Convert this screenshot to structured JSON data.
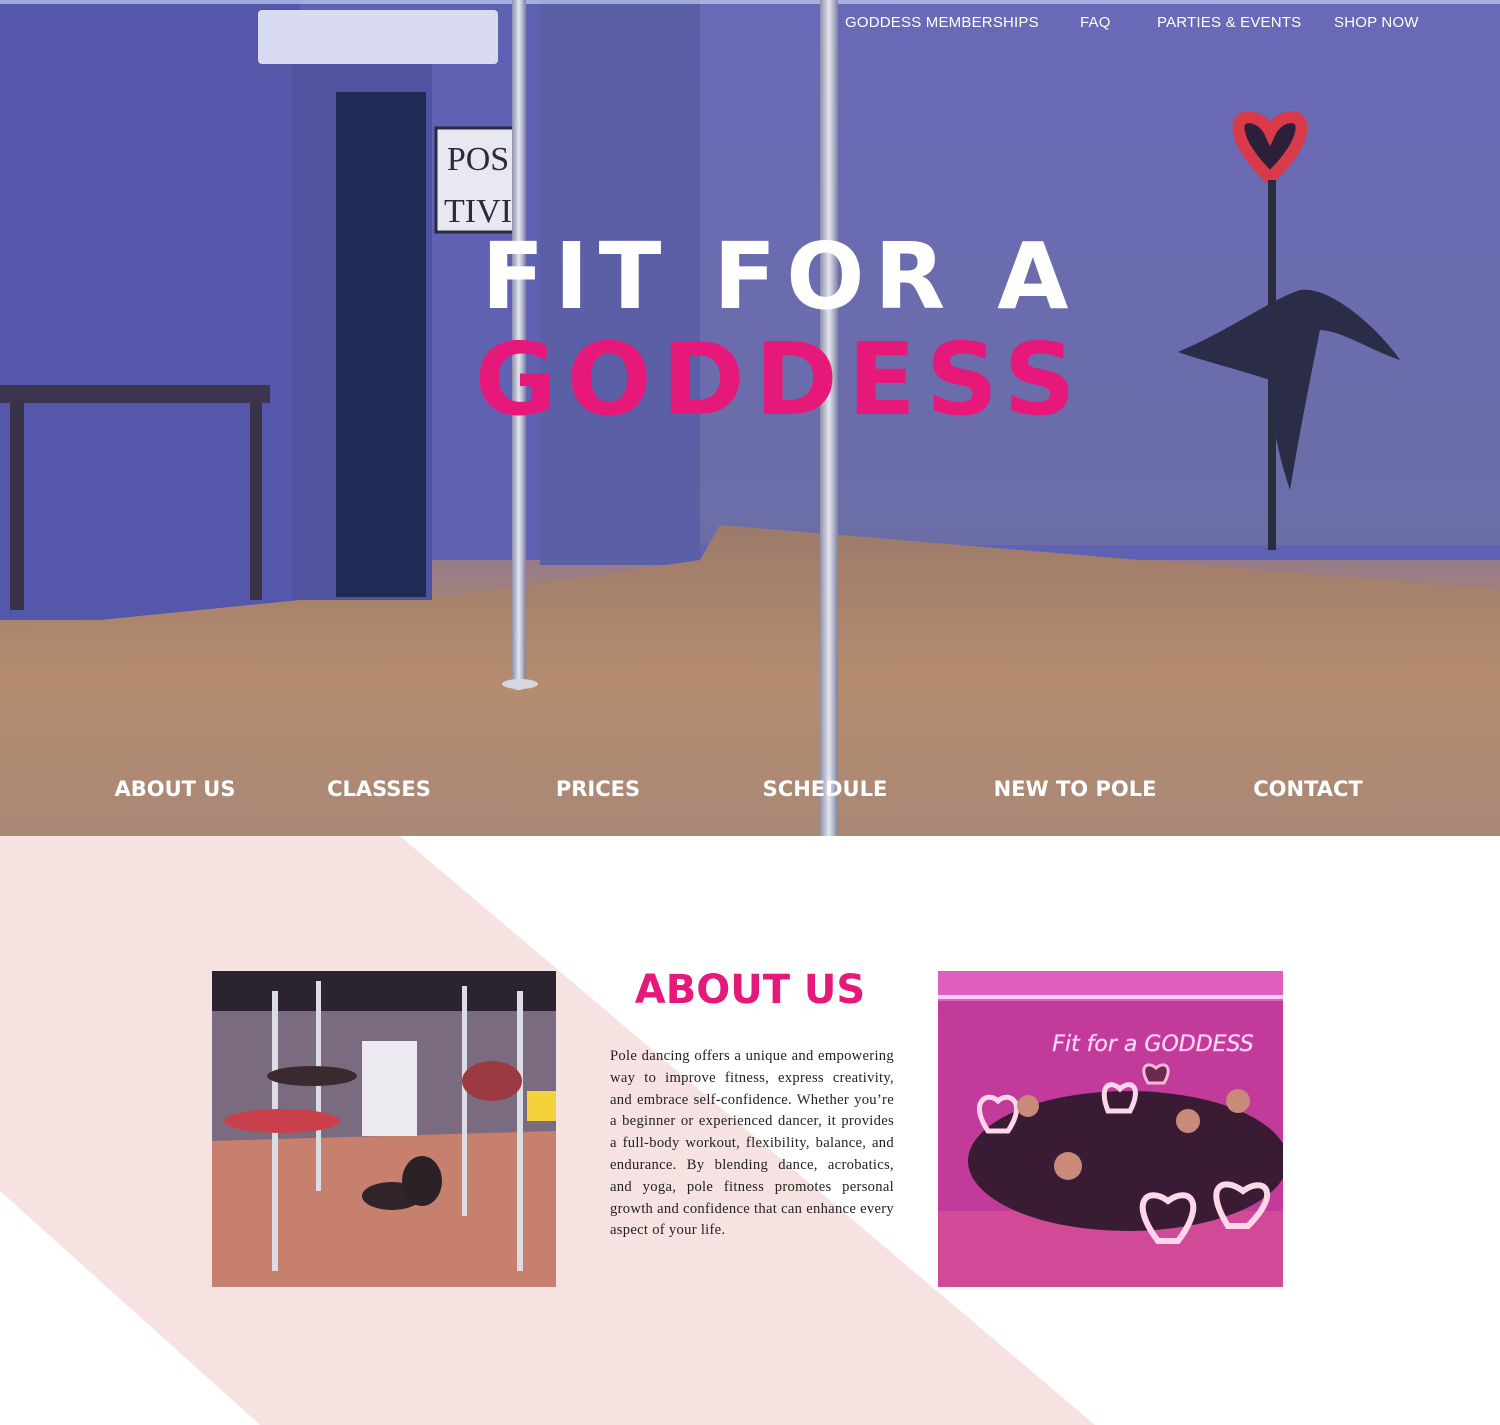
{
  "top_nav": {
    "items": [
      "GODDESS MEMBERSHIPS",
      "FAQ",
      "PARTIES & EVENTS",
      "SHOP NOW"
    ]
  },
  "hero": {
    "line1": "FIT FOR A",
    "line2": "GODDESS",
    "sign_line1": "POS",
    "sign_line2": "TIVI"
  },
  "main_nav": {
    "items": [
      "ABOUT US",
      "CLASSES",
      "PRICES",
      "SCHEDULE",
      "NEW TO POLE",
      "CONTACT"
    ]
  },
  "about": {
    "title": "ABOUT US",
    "body": "Pole dancing offers a unique and empowering way to improve fitness, express creativity, and embrace self-confidence. Whether you’re a beginner or experienced dancer, it provides a full-body workout, flexibility, balance, and endurance. By blending dance, acrobatics, and yoga, pole fitness promotes personal growth and confidence that can enhance every aspect of your life.",
    "neon_sign": "Fit for a GODDESS"
  },
  "colors": {
    "accent_pink": "#e6197a",
    "section_blush": "#f6e3e1",
    "nav_text": "#ffffff"
  }
}
